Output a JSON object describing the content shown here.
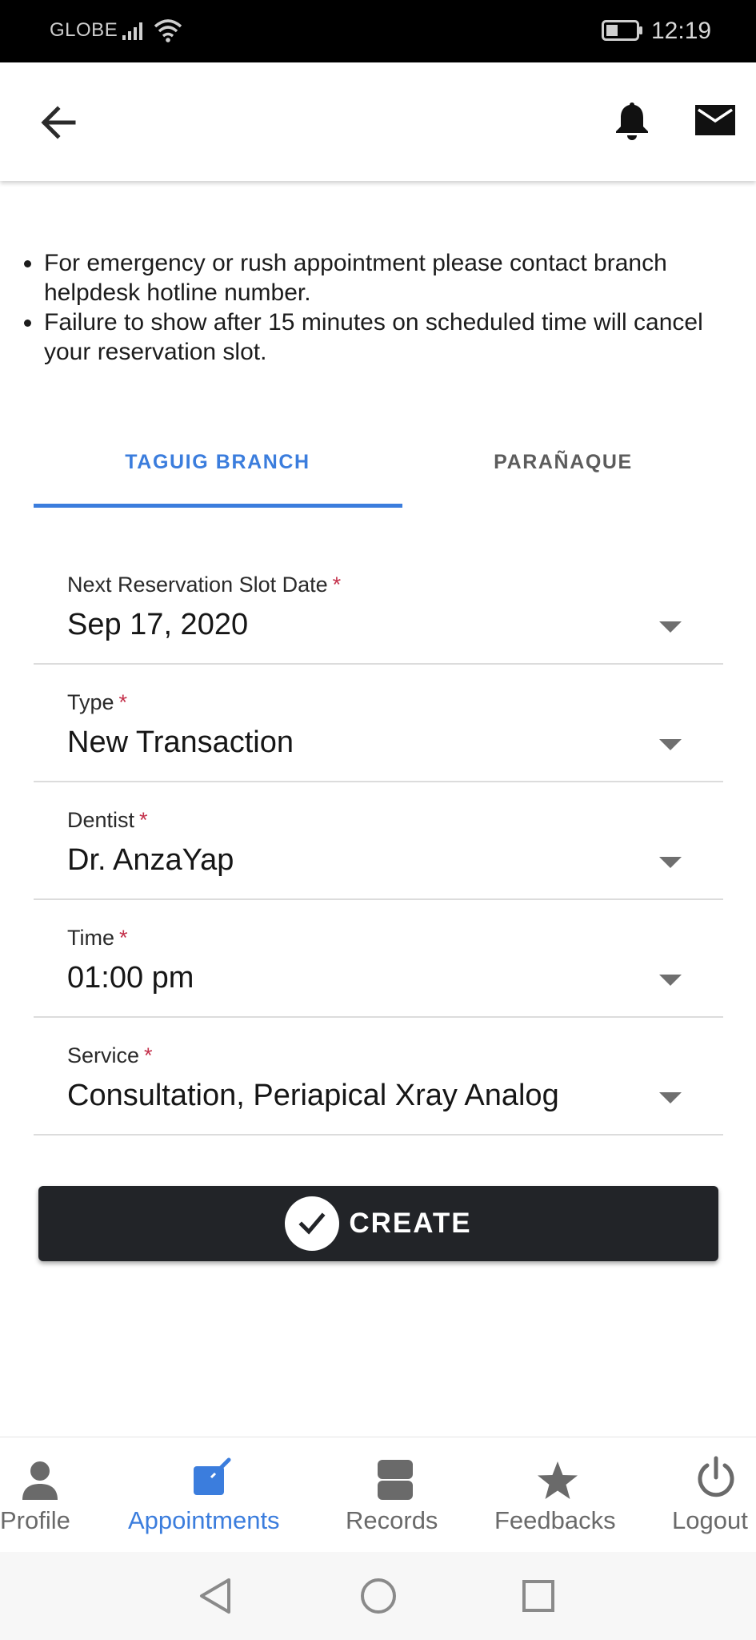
{
  "status_bar": {
    "carrier": "GLOBE",
    "time": "12:19"
  },
  "app_bar": {
    "icons": [
      "arrow-back-icon",
      "bell-icon",
      "mail-icon"
    ]
  },
  "notes": [
    "For emergency or rush appointment please contact branch helpdesk hotline number.",
    "Failure to show after 15 minutes on scheduled time will cancel your reservation slot."
  ],
  "tabs": [
    {
      "label": "TAGUIG BRANCH",
      "selected": true
    },
    {
      "label": "PARAÑAQUE",
      "selected": false
    }
  ],
  "form": {
    "required_marker": "*",
    "fields": [
      {
        "label": "Next Reservation Slot Date",
        "value": "Sep 17, 2020"
      },
      {
        "label": "Type",
        "value": "New Transaction"
      },
      {
        "label": "Dentist",
        "value": "Dr. AnzaYap"
      },
      {
        "label": "Time",
        "value": "01:00 pm"
      },
      {
        "label": "Service",
        "value": "Consultation, Periapical Xray Analog"
      }
    ]
  },
  "create_button": {
    "label": "CREATE",
    "icon": "check-circle-icon"
  },
  "bottom_nav": {
    "items": [
      {
        "label": "Profile",
        "icon": "person-icon",
        "active": false
      },
      {
        "label": "Appointments",
        "icon": "edit-calendar-icon",
        "active": true
      },
      {
        "label": "Records",
        "icon": "records-icon",
        "active": false
      },
      {
        "label": "Feedbacks",
        "icon": "star-icon",
        "active": false
      },
      {
        "label": "Logout",
        "icon": "power-icon",
        "active": false
      }
    ]
  },
  "colors": {
    "accent": "#3b7ddd",
    "required": "#c4314b",
    "button_bg": "#222428"
  },
  "system_nav": [
    "back-triangle-icon",
    "home-circle-icon",
    "recents-square-icon"
  ]
}
